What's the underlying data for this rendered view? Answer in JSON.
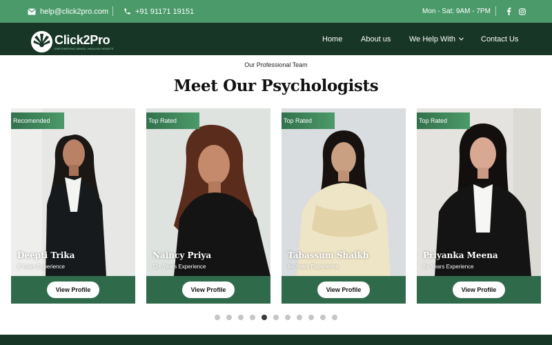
{
  "topbar": {
    "email": "help@click2pro.com",
    "phone": "+91 91171 19151",
    "hours": "Mon - Sat: 9AM - 7PM",
    "social": [
      "facebook-icon",
      "instagram-icon"
    ]
  },
  "nav": {
    "brand": "Click2Pro",
    "tagline": "EMPOWERING MINDS, HEALING HEARTS",
    "links": [
      "Home",
      "About us",
      "We Help With",
      "Contact Us"
    ]
  },
  "section": {
    "eyebrow": "Our Professional Team",
    "title": "Meet Our Psychologists"
  },
  "cards": [
    {
      "badge": "Recomended",
      "name": "Deepti Trika",
      "experience": "6 Years Experience",
      "button": "View Profile"
    },
    {
      "badge": "Top Rated",
      "name": "Naincy Priya",
      "experience": "11+ Years Experience",
      "button": "View Profile"
    },
    {
      "badge": "Top Rated",
      "name": "Tabassum Shaikh",
      "experience": "6+ Years Experience",
      "button": "View Profile"
    },
    {
      "badge": "Top Rated",
      "name": "Priyanka Meena",
      "experience": "8+ Years Experience",
      "button": "View Profile"
    }
  ],
  "carousel": {
    "total": 11,
    "active": 4
  },
  "colors": {
    "topbar": "#4b9a6a",
    "navbar": "#173626",
    "accent": "#2f6b4b"
  }
}
